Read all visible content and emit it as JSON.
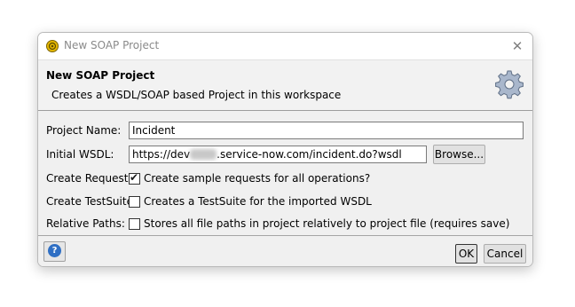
{
  "window": {
    "title": "New SOAP Project"
  },
  "header": {
    "title": "New SOAP Project",
    "description": "Creates a WSDL/SOAP based Project in this workspace"
  },
  "form": {
    "project_name": {
      "label": "Project Name:",
      "value": "Incident"
    },
    "initial_wsdl": {
      "label": "Initial WSDL:",
      "value_prefix": "https://dev",
      "value_suffix": ".service-now.com/incident.do?wsdl",
      "browse_label": "Browse..."
    },
    "create_requests": {
      "label": "Create Requests:",
      "checked": true,
      "option": "Create sample requests for all operations?"
    },
    "create_testsuite": {
      "label": "Create TestSuite:",
      "checked": false,
      "option": "Creates a TestSuite for the imported WSDL"
    },
    "relative_paths": {
      "label": "Relative Paths:",
      "checked": false,
      "option": "Stores all file paths in project relatively to project file (requires save)"
    }
  },
  "footer": {
    "ok_label": "OK",
    "cancel_label": "Cancel"
  },
  "icons": [
    "soapui-app-icon",
    "close-icon",
    "gear-icon",
    "help-icon",
    "checkmark-icon"
  ]
}
